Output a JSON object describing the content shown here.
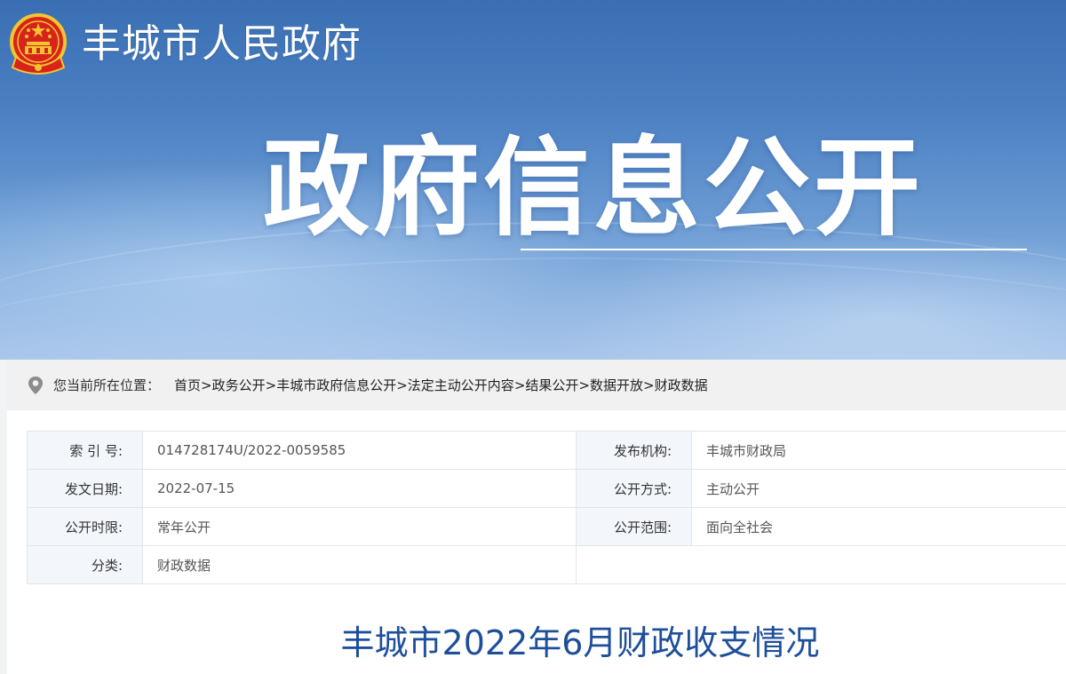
{
  "header": {
    "site_name": "丰城市人民政府",
    "banner_title": "政府信息公开"
  },
  "breadcrumb": {
    "label": "您当前所在位置：",
    "items": [
      "首页",
      "政务公开",
      "丰城市政府信息公开",
      "法定主动公开内容",
      "结果公开",
      "数据开放",
      "财政数据"
    ],
    "separator": ">"
  },
  "meta": {
    "index_no_label": "索 引 号:",
    "index_no": "014728174U/2022-0059585",
    "publisher_label": "发布机构:",
    "publisher": "丰城市财政局",
    "date_label": "发文日期:",
    "date": "2022-07-15",
    "method_label": "公开方式:",
    "method": "主动公开",
    "period_label": "公开时限:",
    "period": "常年公开",
    "scope_label": "公开范围:",
    "scope": "面向全社会",
    "category_label": "分类:",
    "category": "财政数据"
  },
  "article": {
    "title": "丰城市2022年6月财政收支情况"
  },
  "colors": {
    "banner_top": "#3a6fb3",
    "title_blue": "#1e4f9a",
    "emblem_red": "#d8231d",
    "emblem_gold": "#f2c530"
  },
  "icons": {
    "emblem": "national-emblem",
    "location": "location-pin-icon"
  }
}
